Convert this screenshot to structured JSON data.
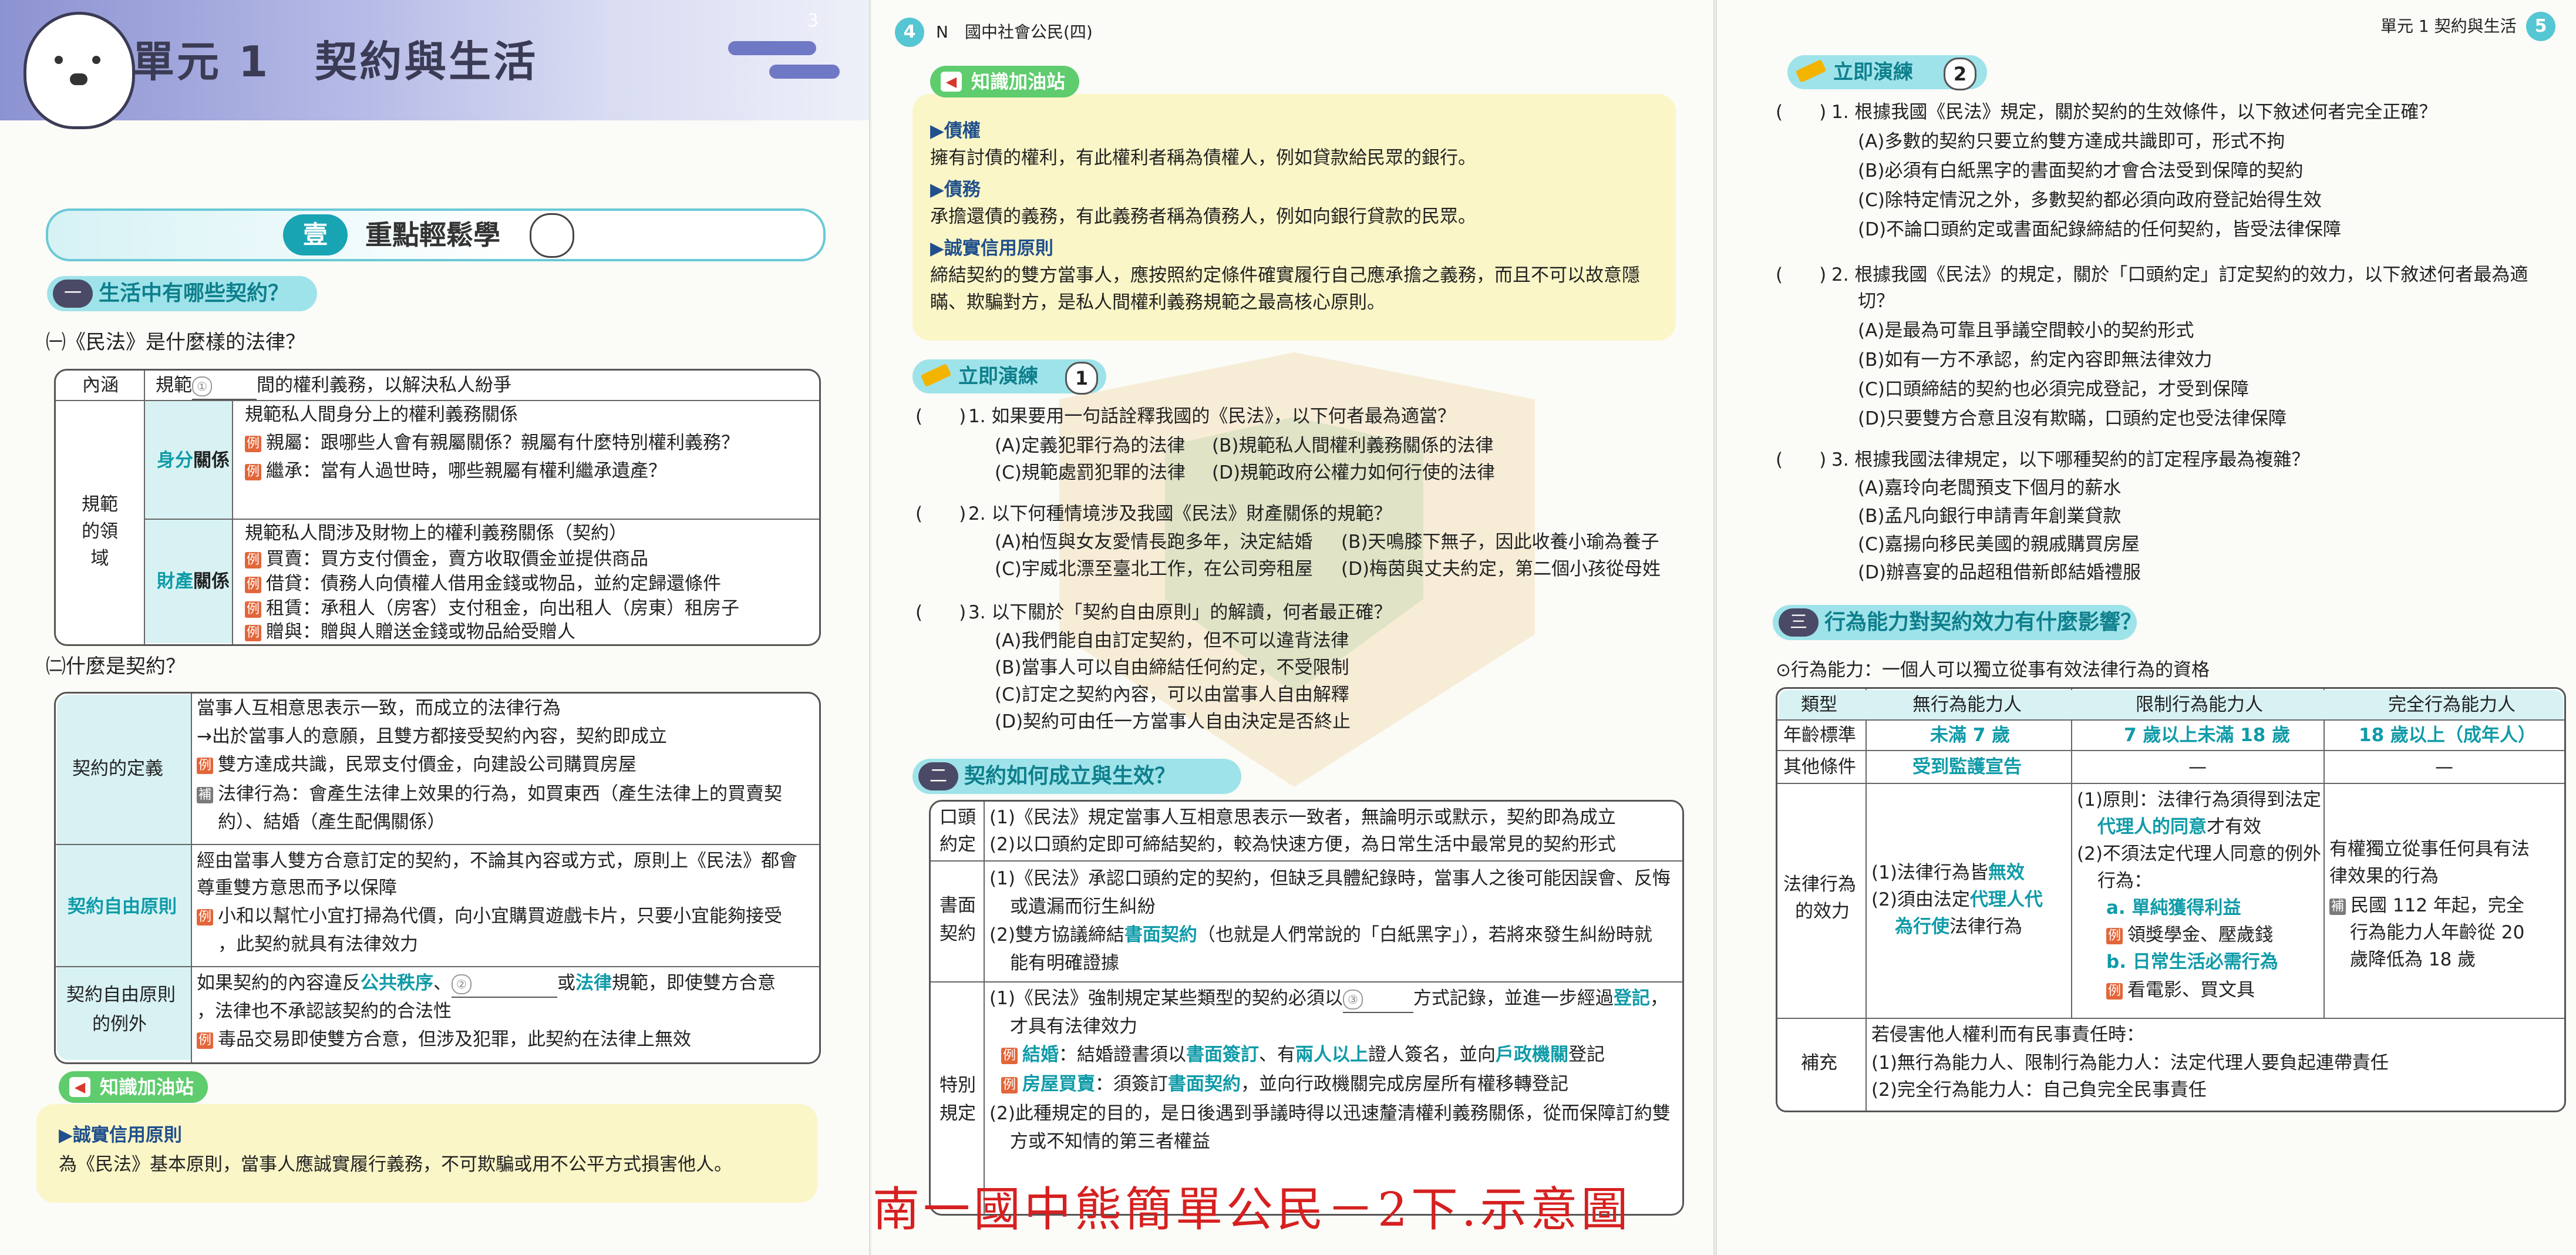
{
  "left": {
    "page_num": "3",
    "unit_title": "單元 1　契約與生活",
    "section_badge": "壹",
    "section_title": "重點輕鬆學",
    "s1": {
      "icon": "一",
      "title": "生活中有哪些契約？"
    },
    "q1_title": "㈠《民法》是什麼樣的法律？",
    "t1": {
      "r0_label": "內涵",
      "r0_text_a": "規範",
      "r0_blank": "①",
      "r0_text_b": "間的權利義務，以解決私人紛爭",
      "side_label": "規範\n的領域",
      "status_label_a": "身分",
      "status_label_b": "關係",
      "status_lines": [
        "規範私人間身分上的權利義務關係",
        "親屬：跟哪些人會有親屬關係？親屬有什麼特別權利義務？",
        "繼承：當有人過世時，哪些親屬有權利繼承遺產？"
      ],
      "prop_label_a": "財產",
      "prop_label_b": "關係",
      "prop_lines": [
        "規範私人間涉及財物上的權利義務關係（契約）",
        "買賣：買方支付價金，賣方收取價金並提供商品",
        "借貸：債務人向債權人借用金錢或物品，並約定歸還條件",
        "租賃：承租人（房客）支付租金，向出租人（房東）租房子",
        "贈與：贈與人贈送金錢或物品給受贈人"
      ],
      "ex_tag": "例"
    },
    "q2_title": "㈡什麼是契約？",
    "t2": {
      "def_label": "契約的定義",
      "def_lines": [
        "當事人互相意思表示一致，而成立的法律行為",
        "→出於當事人的意願，且雙方都接受契約內容，契約即成立",
        "雙方達成共識，民眾支付價金，向建設公司購買房屋",
        "法律行為：會產生法律上效果的行為，如買東西（產生法律上的買賣契",
        "約）、結婚（產生配偶關係）"
      ],
      "free_label": "契約自由原則",
      "free_lines": [
        "經由當事人雙方合意訂定的契約，不論其內容或方式，原則上《民法》都會",
        "尊重雙方意思而予以保障",
        "小和以幫忙小宜打掃為代價，向小宜購買遊戲卡片，只要小宜能夠接受",
        "，此契約就具有法律效力"
      ],
      "exc_label_a": "契約自由原則",
      "exc_label_b": "的例外",
      "exc_lines_a": "如果契約的內容違反",
      "exc_public": "公共秩序",
      "exc_blank": "②",
      "exc_or": "或",
      "exc_law": "法律",
      "exc_tail": "規範，即使雙方合意",
      "exc_line2": "，法律也不承認該契約的合法性",
      "exc_line3": "毒品交易即使雙方合意，但涉及犯罪，此契約在法律上無效",
      "ex_tag": "例",
      "sup_tag": "補"
    },
    "knote": {
      "label": "知識加油站",
      "head": "▶誠實信用原則",
      "body": "為《民法》基本原則，當事人應誠實履行義務，不可欺騙或用不公平方式損害他人。"
    }
  },
  "mid": {
    "page_num": "4",
    "header": "N　國中社會公民(四)",
    "knote": {
      "label": "知識加油站",
      "items": [
        {
          "head": "▶債權",
          "body": [
            "擁有討債的權利，有此權利者稱為債權人，例如貸款給民眾的銀行。"
          ]
        },
        {
          "head": "▶債務",
          "body": [
            "承擔還債的義務，有此義務者稱為債務人，例如向銀行貸款的民眾。"
          ]
        },
        {
          "head": "▶誠實信用原則",
          "body": [
            "締結契約的雙方當事人，應按照約定條件確實履行自己應承擔之義務，而且不可以故意隱",
            "瞞、欺騙對方，是私人間權利義務規範之最高核心原則。"
          ]
        }
      ]
    },
    "drill": {
      "label": "立即演練",
      "num": "1"
    },
    "qs": [
      {
        "paren": "(　　)",
        "stem": "1. 如果要用一句話詮釋我國的《民法》，以下何者最為適當？",
        "opts": [
          "(A)定義犯罪行為的法律",
          "(B)規範私人間權利義務關係的法律",
          "(C)規範處罰犯罪的法律",
          "(D)規範政府公權力如何行使的法律"
        ]
      },
      {
        "paren": "(　　)",
        "stem": "2. 以下何種情境涉及我國《民法》財產關係的規範？",
        "opts": [
          "(A)柏恆與女友愛情長跑多年，決定結婚",
          "(B)天鳴膝下無子，因此收養小瑜為養子",
          "(C)宇威北漂至臺北工作，在公司旁租屋",
          "(D)梅茵與丈夫約定，第二個小孩從母姓"
        ]
      },
      {
        "paren": "(　　)",
        "stem": "3. 以下關於「契約自由原則」的解讀，何者最正確？",
        "opts": [
          "(A)我們能自由訂定契約，但不可以違背法律",
          "(B)當事人可以自由締結任何約定，不受限制",
          "(C)訂定之契約內容，可以由當事人自由解釋",
          "(D)契約可由任一方當事人自由決定是否終止"
        ]
      }
    ],
    "s2": {
      "icon": "二",
      "title": "契約如何成立與生效？"
    },
    "t3": {
      "oral_label_a": "口頭",
      "oral_label_b": "約定",
      "oral_lines": [
        "(1)《民法》規定當事人互相意思表示一致者，無論明示或默示，契約即為成立",
        "(2)以口頭約定即可締結契約，較為快速方便，為日常生活中最常見的契約形式"
      ],
      "writ_label_a": "書面",
      "writ_label_b": "契約",
      "writ_lines": [
        "(1)《民法》承認口頭約定的契約，但缺乏具體紀錄時，當事人之後可能因誤會、反悔",
        "或遺漏而衍生糾紛",
        "(2)雙方協議締結",
        "書面契約",
        "（也就是人們常說的「白紙黑字」），若將來發生糾紛時就",
        "能有明確證據"
      ],
      "spec_label_a": "特別",
      "spec_label_b": "規定",
      "spec_lines": [
        "(1)《民法》強制規定某些類型的契約必須以",
        "③",
        "方式記錄，並進一步經過",
        "登記",
        "，",
        "才具有法律效力",
        "結婚",
        "：結婚證書須以",
        "書面簽訂",
        "、有",
        "兩人以上",
        "證人簽名，並向",
        "戶政機關",
        "登記",
        "房屋買賣",
        "：須簽訂",
        "書面契約",
        "，並向行政機關完成房屋所有權移轉登記",
        "(2)此種規定的目的，是日後遇到爭議時得以迅速釐清權利義務關係，從而保障訂約雙",
        "方或不知情的第三者權益"
      ],
      "ex_tag": "例"
    },
    "caption": "南一國中熊簡單公民－2下.示意圖"
  },
  "right": {
    "page_num": "5",
    "header": "單元 1 契約與生活",
    "drill": {
      "label": "立即演練",
      "num": "2"
    },
    "qs": [
      {
        "paren": "(　　)",
        "stem": [
          "1. 根據我國《民法》規定，關於契約的生效條件，以下敘述何者完全正確？"
        ],
        "opts": [
          "(A)多數的契約只要立約雙方達成共識即可，形式不拘",
          "(B)必須有白紙黑字的書面契約才會合法受到保障的契約",
          "(C)除特定情況之外，多數契約都必須向政府登記始得生效",
          "(D)不論口頭約定或書面紀錄締結的任何契約，皆受法律保障"
        ]
      },
      {
        "paren": "(　　)",
        "stem": [
          "2. 根據我國《民法》的規定，關於「口頭約定」訂定契約的效力，以下敘述何者最為適",
          "切？"
        ],
        "opts": [
          "(A)是最為可靠且爭議空間較小的契約形式",
          "(B)如有一方不承認，約定內容即無法律效力",
          "(C)口頭締結的契約也必須完成登記，才受到保障",
          "(D)只要雙方合意且沒有欺瞞，口頭約定也受法律保障"
        ]
      },
      {
        "paren": "(　　)",
        "stem": [
          "3. 根據我國法律規定，以下哪種契約的訂定程序最為複雜？"
        ],
        "opts": [
          "(A)嘉玲向老闆預支下個月的薪水",
          "(B)孟凡向銀行申請青年創業貸款",
          "(C)嘉揚向移民美國的親戚購買房屋",
          "(D)辦喜宴的品超租借新郎結婚禮服"
        ]
      }
    ],
    "s3": {
      "icon": "三",
      "title": "行為能力對契約效力有什麼影響？"
    },
    "def_line": "⊙行為能力：一個人可以獨立從事有效法律行為的資格",
    "t4": {
      "head": [
        "類型",
        "無行為能力人",
        "限制行為能力人",
        "完全行為能力人"
      ],
      "age_label": "年齡標準",
      "age": [
        "未滿 7 歲",
        "7 歲以上未滿 18 歲",
        "18 歲以上（成年人）"
      ],
      "cond_label": "其他條件",
      "cond": [
        "受到監護宣告",
        "—",
        "—"
      ],
      "eff_label_a": "法律行為",
      "eff_label_b": "的效力",
      "eff_none": [
        "(1)法律行為皆",
        "無效",
        "(2)須由法定",
        "代理人代",
        "為行使",
        "法律行為"
      ],
      "eff_limited": [
        "(1)原則：法律行為須得到法定",
        "代理人的同意",
        "才有效",
        "(2)不須法定代理人同意的例外",
        "行為：",
        "a. 單純獲得利益",
        "領獎學金、壓歲錢",
        "b. 日常生活必需行為",
        "看電影、買文具"
      ],
      "eff_full": [
        "有權獨立從事任何具有法",
        "律效果的行為",
        "民國 112 年起，完全",
        "行為能力人年齡從 20",
        "歲降低為 18 歲"
      ],
      "sup_label": "補充",
      "sup_lines": [
        "若侵害他人權利而有民事責任時：",
        "(1)無行為能力人、限制行為能力人：法定代理人要負起連帶責任",
        "(2)完全行為能力人：自己負完全民事責任"
      ],
      "ex_tag": "例",
      "sup_tag": "補"
    }
  },
  "colors": {
    "teal": "#0f9ba8",
    "pill": "#9fe3ea",
    "accent_red": "#d6392b",
    "note_yellow": "#fbf6c7",
    "header_purple": "#8c93d1"
  }
}
